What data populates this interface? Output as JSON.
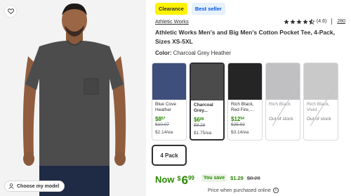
{
  "product_image": {
    "model_button_label": "Choose my model",
    "favorite_icon": "heart-icon",
    "model_icon": "person-icon"
  },
  "badges": {
    "clearance": "Clearance",
    "best_seller": "Best seller"
  },
  "brand": "Athletic Works",
  "rating": {
    "value": 4.6,
    "value_text": "(4.6)",
    "reviews": "280",
    "stars_filled": 4.5
  },
  "title": "Athletic Works Men's and Big Men's Cotton Pocket Tee, 4-Pack, Sizes XS-5XL",
  "color": {
    "label": "Color:",
    "value": "Charcoal Grey Heather"
  },
  "swatches": [
    {
      "name": "Blue Cove Heather",
      "price_whole": "$8",
      "price_cents": "57",
      "was": "$10.07",
      "unit": "$2.14/ea",
      "out_of_stock": "",
      "color_hex": "#3f4f7c"
    },
    {
      "name": "Charcoal Grey...",
      "price_whole": "$6",
      "price_cents": "99",
      "was": "$8.28",
      "unit": "$1.75/ea",
      "out_of_stock": "",
      "color_hex": "#4b4b4c"
    },
    {
      "name": "Rich Black, Red Fire,...",
      "price_whole": "$12",
      "price_cents": "54",
      "was": "$25.92",
      "unit": "$3.14/ea",
      "out_of_stock": "",
      "color_hex": "#252525"
    },
    {
      "name": "Rich Black",
      "price_whole": "",
      "price_cents": "",
      "was": "",
      "unit": "",
      "out_of_stock": "Out of stock",
      "color_hex": "#8d8d8f"
    },
    {
      "name": "Rich Black, Vivid...",
      "price_whole": "",
      "price_cents": "",
      "was": "",
      "unit": "",
      "out_of_stock": "Out of stock",
      "color_hex": "#9c9c9e"
    }
  ],
  "size": {
    "selected": "4 Pack"
  },
  "price": {
    "now_label": "Now",
    "currency": "$",
    "whole": "6",
    "cents": "99",
    "save_label": "You save",
    "save_amount": "$1.29",
    "was": "$8.28",
    "hint": "Price when purchased online"
  },
  "colors": {
    "accent_green": "#2a8703",
    "clearance_yellow": "#fff200",
    "brand_blue": "#0053e2"
  }
}
